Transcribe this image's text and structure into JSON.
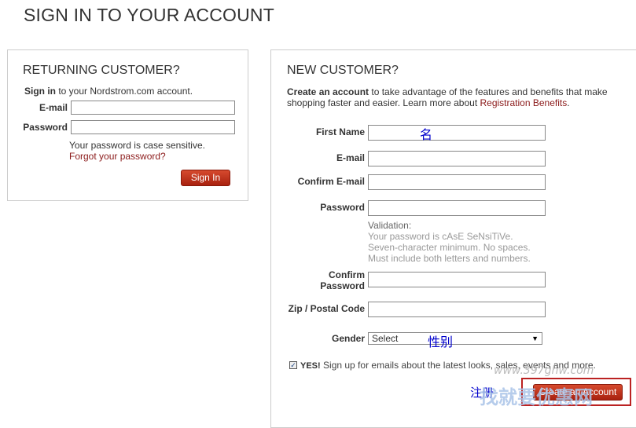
{
  "page": {
    "title": "SIGN IN TO YOUR ACCOUNT"
  },
  "returning": {
    "title": "RETURNING CUSTOMER?",
    "intro_bold": "Sign in",
    "intro_rest": " to your Nordstrom.com account.",
    "email_label": "E-mail",
    "password_label": "Password",
    "email_value": "",
    "password_value": "",
    "case_note": "Your password is case sensitive.",
    "forgot_link": "Forgot your password?",
    "signin_button": "Sign In"
  },
  "new_customer": {
    "title": "NEW CUSTOMER?",
    "intro_bold": "Create an account",
    "intro_rest1": " to take advantage of the features and benefits that make",
    "intro_rest2": "shopping faster and easier. Learn more about ",
    "benefits_link": "Registration Benefits",
    "benefits_tail": ".",
    "fields": {
      "first_name": "First Name",
      "email": "E-mail",
      "confirm_email": "Confirm E-mail",
      "password": "Password",
      "confirm_password_1": "Confirm",
      "confirm_password_2": "Password",
      "zip": "Zip / Postal Code",
      "gender": "Gender"
    },
    "validation": {
      "title": "Validation:",
      "line1": "Your password is cAsE SeNsiTiVe.",
      "line2": "Seven-character minimum. No spaces.",
      "line3": "Must include both letters and numbers."
    },
    "gender_selected": "Select",
    "email_optin_bold": "YES!",
    "email_optin_text": " Sign up for emails about the latest looks, sales, events and more.",
    "email_optin_checked": true,
    "create_button": "Create an Account"
  },
  "annotations": {
    "first_name_note": "名",
    "gender_note": "性别",
    "create_note": "注册"
  },
  "watermark": {
    "url": "www.397ghw.com",
    "site": "找就要优惠网"
  },
  "colors": {
    "accent_red": "#a8210f",
    "link": "#8b1a1a",
    "annotation_blue": "#0000cc"
  }
}
